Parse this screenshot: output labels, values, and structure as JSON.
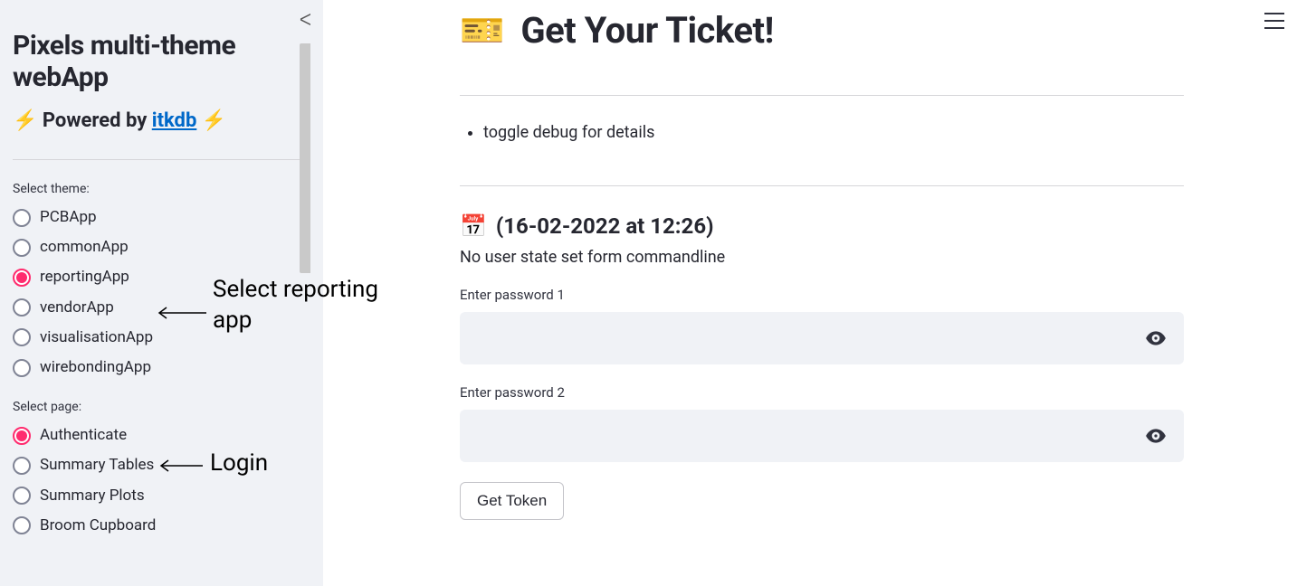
{
  "sidebar": {
    "title": "Pixels multi-theme webApp",
    "powered_prefix": "⚡ Powered by ",
    "powered_link": "itkdb",
    "powered_suffix": " ⚡",
    "theme_label": "Select theme:",
    "themes": [
      "PCBApp",
      "commonApp",
      "reportingApp",
      "vendorApp",
      "visualisationApp",
      "wirebondingApp"
    ],
    "selected_theme_index": 2,
    "page_label": "Select page:",
    "pages": [
      "Authenticate",
      "Summary Tables",
      "Summary Plots",
      "Broom Cupboard"
    ],
    "selected_page_index": 0
  },
  "main": {
    "title_emoji": "🎫",
    "title": "Get Your Ticket!",
    "bullet_items": [
      "toggle debug for details"
    ],
    "date_emoji": "📅",
    "date_text": "(16-02-2022 at 12:26)",
    "status": "No user state set form commandline",
    "pw1_label": "Enter password 1",
    "pw2_label": "Enter password 2",
    "button_label": "Get Token"
  },
  "annotations": {
    "select_reporting": "Select reporting app",
    "login": "Login"
  }
}
